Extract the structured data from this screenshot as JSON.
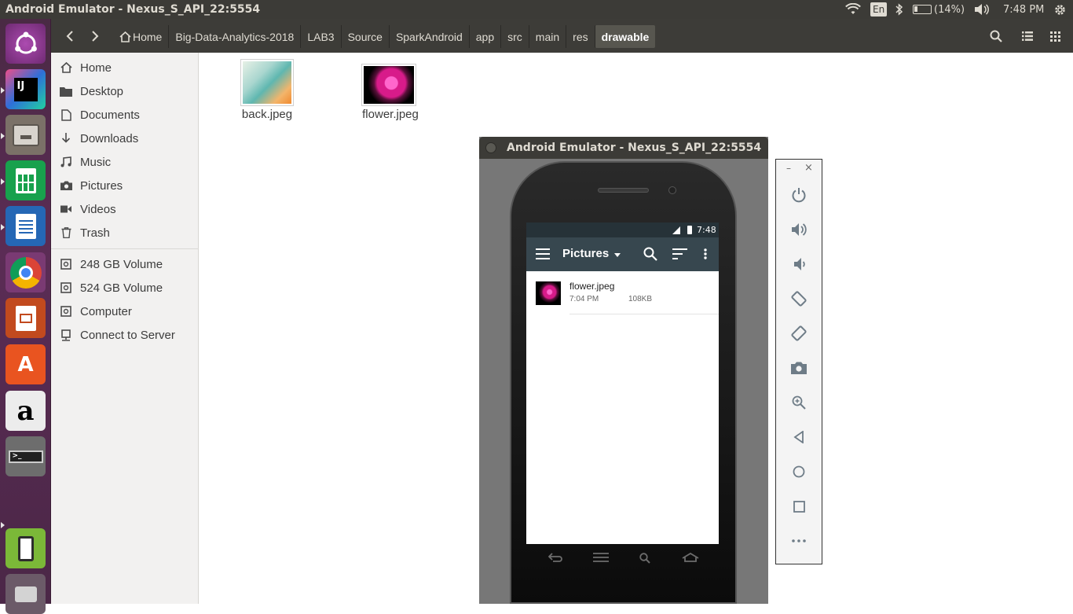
{
  "top_panel": {
    "title": "Android Emulator - Nexus_S_API_22:5554",
    "keyboard": "En",
    "battery": "(14%)",
    "clock": "7:48 PM"
  },
  "launcher": {
    "apps": [
      "ubuntu-dash",
      "intellij-idea",
      "file-manager",
      "libreoffice-calc",
      "libreoffice-writer",
      "chrome",
      "libreoffice-impress",
      "ubuntu-software",
      "amazon",
      "stacked-apps",
      "android-emulator",
      "trash"
    ]
  },
  "toolbar": {
    "breadcrumb": [
      "Home",
      "Big-Data-Analytics-2018",
      "LAB3",
      "Source",
      "SparkAndroid",
      "app",
      "src",
      "main",
      "res",
      "drawable"
    ]
  },
  "sidebar": {
    "places": [
      "Home",
      "Desktop",
      "Documents",
      "Downloads",
      "Music",
      "Pictures",
      "Videos",
      "Trash"
    ],
    "devices": [
      "248 GB Volume",
      "524 GB Volume",
      "Computer",
      "Connect to Server"
    ]
  },
  "files": [
    {
      "name": "back.jpeg"
    },
    {
      "name": "flower.jpeg"
    }
  ],
  "emulator": {
    "window_title": "Android Emulator - Nexus_S_API_22:5554",
    "status_time": "7:48",
    "app_title": "Pictures",
    "items": [
      {
        "name": "flower.jpeg",
        "time": "7:04 PM",
        "size": "108KB"
      }
    ],
    "side_buttons": [
      "power-icon",
      "volume-up-icon",
      "volume-down-icon",
      "rotate-left-icon",
      "rotate-right-icon",
      "camera-icon",
      "zoom-icon",
      "back-icon",
      "home-icon",
      "overview-icon",
      "more-icon"
    ]
  },
  "colors": {
    "panel": "#3c3b37",
    "launcher": "#5b2c55",
    "app_bar": "#37474f",
    "status_bar": "#263238"
  }
}
